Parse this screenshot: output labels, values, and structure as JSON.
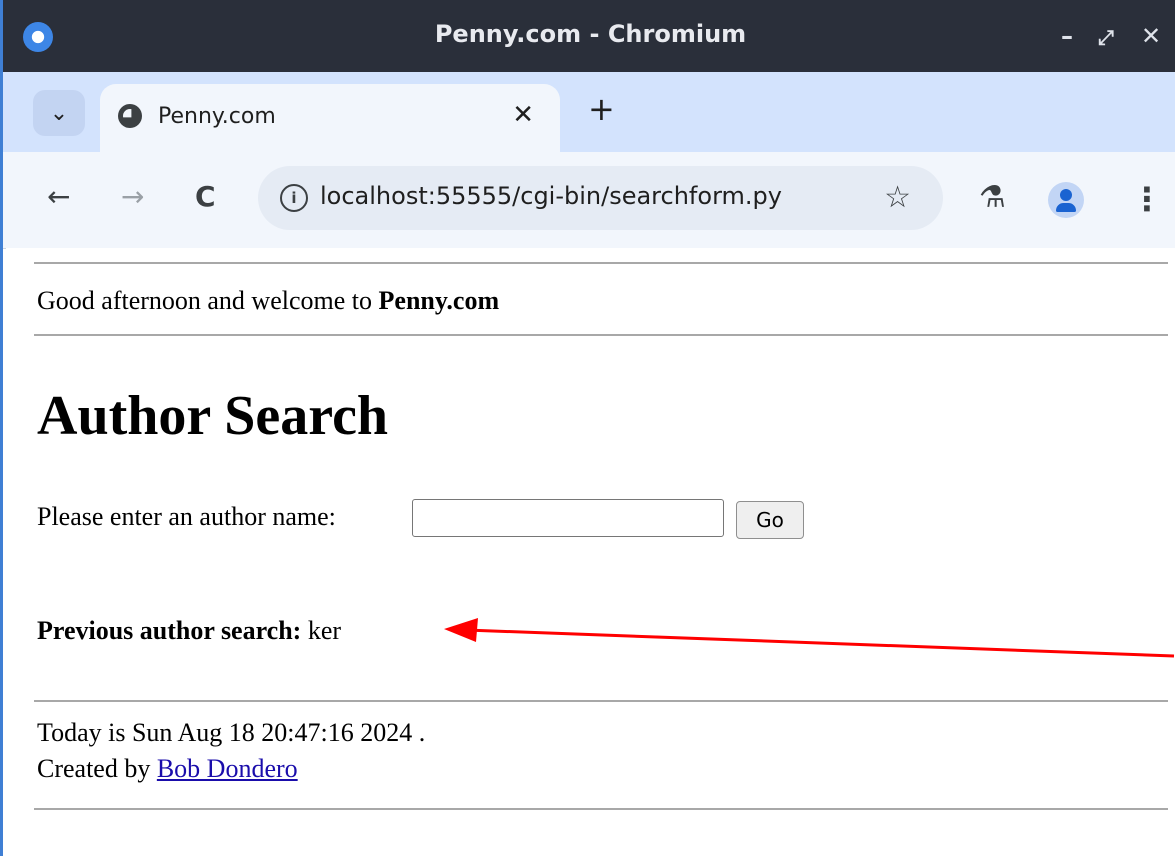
{
  "window": {
    "title": "Penny.com - Chromium",
    "minimize": "–",
    "restore": "⤢",
    "close": "✕"
  },
  "tabs": {
    "dropdown": "⌄",
    "active_title": "Penny.com",
    "close": "✕",
    "new_tab": "+"
  },
  "toolbar": {
    "back": "←",
    "forward": "→",
    "reload": "C",
    "info_icon": "i",
    "url": "localhost:55555/cgi-bin/searchform.py",
    "star": "☆",
    "labs": "⚗",
    "menu": "⋮"
  },
  "page": {
    "greeting_prefix": "Good afternoon and welcome to ",
    "greeting_site": "Penny.com",
    "heading": "Author Search",
    "prompt_label": "Please enter an author name:",
    "search_value": "",
    "go_label": "Go",
    "previous_label": "Previous author search:",
    "previous_value": "ker",
    "date_line": "Today is Sun Aug 18 20:47:16 2024 .",
    "created_by_prefix": "Created by ",
    "creator_link": "Bob Dondero"
  },
  "annotation": {
    "arrow_color": "#ff0000"
  }
}
